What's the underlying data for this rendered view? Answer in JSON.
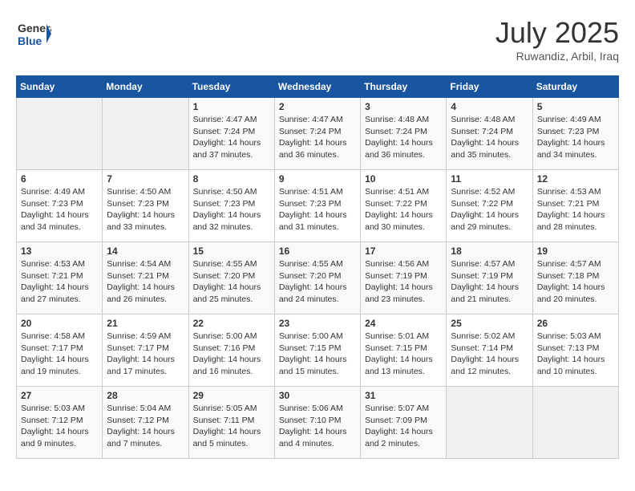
{
  "header": {
    "logo_general": "General",
    "logo_blue": "Blue",
    "month_title": "July 2025",
    "location": "Ruwandiz, Arbil, Iraq"
  },
  "days_of_week": [
    "Sunday",
    "Monday",
    "Tuesday",
    "Wednesday",
    "Thursday",
    "Friday",
    "Saturday"
  ],
  "weeks": [
    [
      {
        "day": "",
        "empty": true
      },
      {
        "day": "",
        "empty": true
      },
      {
        "day": "1",
        "sunrise": "4:47 AM",
        "sunset": "7:24 PM",
        "daylight": "14 hours and 37 minutes."
      },
      {
        "day": "2",
        "sunrise": "4:47 AM",
        "sunset": "7:24 PM",
        "daylight": "14 hours and 36 minutes."
      },
      {
        "day": "3",
        "sunrise": "4:48 AM",
        "sunset": "7:24 PM",
        "daylight": "14 hours and 36 minutes."
      },
      {
        "day": "4",
        "sunrise": "4:48 AM",
        "sunset": "7:24 PM",
        "daylight": "14 hours and 35 minutes."
      },
      {
        "day": "5",
        "sunrise": "4:49 AM",
        "sunset": "7:23 PM",
        "daylight": "14 hours and 34 minutes."
      }
    ],
    [
      {
        "day": "6",
        "sunrise": "4:49 AM",
        "sunset": "7:23 PM",
        "daylight": "14 hours and 34 minutes."
      },
      {
        "day": "7",
        "sunrise": "4:50 AM",
        "sunset": "7:23 PM",
        "daylight": "14 hours and 33 minutes."
      },
      {
        "day": "8",
        "sunrise": "4:50 AM",
        "sunset": "7:23 PM",
        "daylight": "14 hours and 32 minutes."
      },
      {
        "day": "9",
        "sunrise": "4:51 AM",
        "sunset": "7:23 PM",
        "daylight": "14 hours and 31 minutes."
      },
      {
        "day": "10",
        "sunrise": "4:51 AM",
        "sunset": "7:22 PM",
        "daylight": "14 hours and 30 minutes."
      },
      {
        "day": "11",
        "sunrise": "4:52 AM",
        "sunset": "7:22 PM",
        "daylight": "14 hours and 29 minutes."
      },
      {
        "day": "12",
        "sunrise": "4:53 AM",
        "sunset": "7:21 PM",
        "daylight": "14 hours and 28 minutes."
      }
    ],
    [
      {
        "day": "13",
        "sunrise": "4:53 AM",
        "sunset": "7:21 PM",
        "daylight": "14 hours and 27 minutes."
      },
      {
        "day": "14",
        "sunrise": "4:54 AM",
        "sunset": "7:21 PM",
        "daylight": "14 hours and 26 minutes."
      },
      {
        "day": "15",
        "sunrise": "4:55 AM",
        "sunset": "7:20 PM",
        "daylight": "14 hours and 25 minutes."
      },
      {
        "day": "16",
        "sunrise": "4:55 AM",
        "sunset": "7:20 PM",
        "daylight": "14 hours and 24 minutes."
      },
      {
        "day": "17",
        "sunrise": "4:56 AM",
        "sunset": "7:19 PM",
        "daylight": "14 hours and 23 minutes."
      },
      {
        "day": "18",
        "sunrise": "4:57 AM",
        "sunset": "7:19 PM",
        "daylight": "14 hours and 21 minutes."
      },
      {
        "day": "19",
        "sunrise": "4:57 AM",
        "sunset": "7:18 PM",
        "daylight": "14 hours and 20 minutes."
      }
    ],
    [
      {
        "day": "20",
        "sunrise": "4:58 AM",
        "sunset": "7:17 PM",
        "daylight": "14 hours and 19 minutes."
      },
      {
        "day": "21",
        "sunrise": "4:59 AM",
        "sunset": "7:17 PM",
        "daylight": "14 hours and 17 minutes."
      },
      {
        "day": "22",
        "sunrise": "5:00 AM",
        "sunset": "7:16 PM",
        "daylight": "14 hours and 16 minutes."
      },
      {
        "day": "23",
        "sunrise": "5:00 AM",
        "sunset": "7:15 PM",
        "daylight": "14 hours and 15 minutes."
      },
      {
        "day": "24",
        "sunrise": "5:01 AM",
        "sunset": "7:15 PM",
        "daylight": "14 hours and 13 minutes."
      },
      {
        "day": "25",
        "sunrise": "5:02 AM",
        "sunset": "7:14 PM",
        "daylight": "14 hours and 12 minutes."
      },
      {
        "day": "26",
        "sunrise": "5:03 AM",
        "sunset": "7:13 PM",
        "daylight": "14 hours and 10 minutes."
      }
    ],
    [
      {
        "day": "27",
        "sunrise": "5:03 AM",
        "sunset": "7:12 PM",
        "daylight": "14 hours and 9 minutes."
      },
      {
        "day": "28",
        "sunrise": "5:04 AM",
        "sunset": "7:12 PM",
        "daylight": "14 hours and 7 minutes."
      },
      {
        "day": "29",
        "sunrise": "5:05 AM",
        "sunset": "7:11 PM",
        "daylight": "14 hours and 5 minutes."
      },
      {
        "day": "30",
        "sunrise": "5:06 AM",
        "sunset": "7:10 PM",
        "daylight": "14 hours and 4 minutes."
      },
      {
        "day": "31",
        "sunrise": "5:07 AM",
        "sunset": "7:09 PM",
        "daylight": "14 hours and 2 minutes."
      },
      {
        "day": "",
        "empty": true
      },
      {
        "day": "",
        "empty": true
      }
    ]
  ]
}
